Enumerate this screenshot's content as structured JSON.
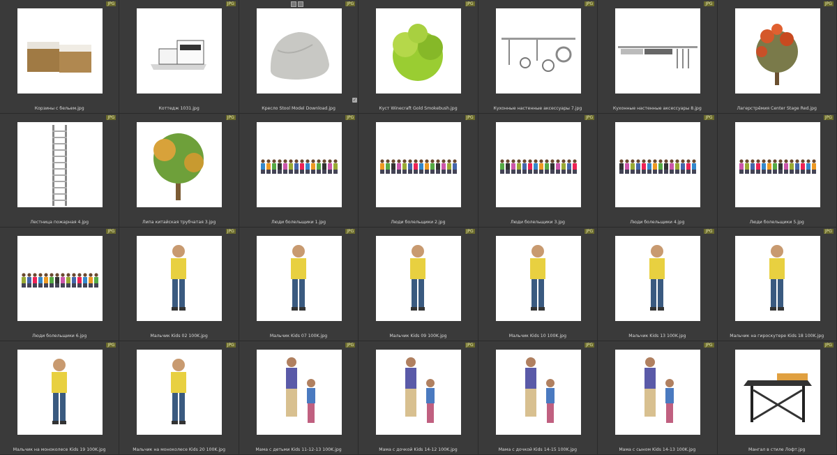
{
  "badge_label": "JPG",
  "items": [
    {
      "name": "Корзины с бельем.jpg",
      "icon": "baskets"
    },
    {
      "name": "Коттедж 1031.jpg",
      "icon": "house"
    },
    {
      "name": "Кресло Stool Model Download.jpg",
      "icon": "beanbag"
    },
    {
      "name": "Куст Winecraft Gold Smokebush.jpg",
      "icon": "bush"
    },
    {
      "name": "Кухонные настенные аксессуары 7.jpg",
      "icon": "kitchen7"
    },
    {
      "name": "Кухонные настенные аксессуары 8.jpg",
      "icon": "kitchen8"
    },
    {
      "name": "Лагерстрёмия Center Stage Red.jpg",
      "icon": "redplant"
    },
    {
      "name": "Лестница пожарная 4.jpg",
      "icon": "ladder"
    },
    {
      "name": "Липа китайская трубчатая 3.jpg",
      "icon": "tree"
    },
    {
      "name": "Люди болельщики 1.jpg",
      "icon": "crowd"
    },
    {
      "name": "Люди болельщики 2.jpg",
      "icon": "crowd"
    },
    {
      "name": "Люди болельщики 3.jpg",
      "icon": "crowd"
    },
    {
      "name": "Люди болельщики 4.jpg",
      "icon": "crowd"
    },
    {
      "name": "Люди болельщики 5.jpg",
      "icon": "crowd"
    },
    {
      "name": "Люди болельщики 6.jpg",
      "icon": "crowd"
    },
    {
      "name": "Мальчик Kids 02 100K.jpg",
      "icon": "boy"
    },
    {
      "name": "Мальчик Kids 07 100K.jpg",
      "icon": "boy"
    },
    {
      "name": "Мальчик Kids 09 100K.jpg",
      "icon": "boy"
    },
    {
      "name": "Мальчик Kids 10 100K.jpg",
      "icon": "boy"
    },
    {
      "name": "Мальчик Kids 13 100K.jpg",
      "icon": "boy"
    },
    {
      "name": "Мальчик на гироскутере Kids 18 100K.jpg",
      "icon": "boy"
    },
    {
      "name": "Мальчик на моноколесе Kids 19 100K.jpg",
      "icon": "boy"
    },
    {
      "name": "Мальчик на моноколесе Kids 20 100K.jpg",
      "icon": "boy"
    },
    {
      "name": "Мама с детьми Kids 11-12-13 100K.jpg",
      "icon": "family"
    },
    {
      "name": "Мама с дочкой Kids 14-12 100K.jpg",
      "icon": "family"
    },
    {
      "name": "Мама с дочкой Kids 14-15 100K.jpg",
      "icon": "family"
    },
    {
      "name": "Мама с сыном Kids 14-13 100K.jpg",
      "icon": "family"
    },
    {
      "name": "Мангал в стиле Лофт.jpg",
      "icon": "grill"
    }
  ]
}
